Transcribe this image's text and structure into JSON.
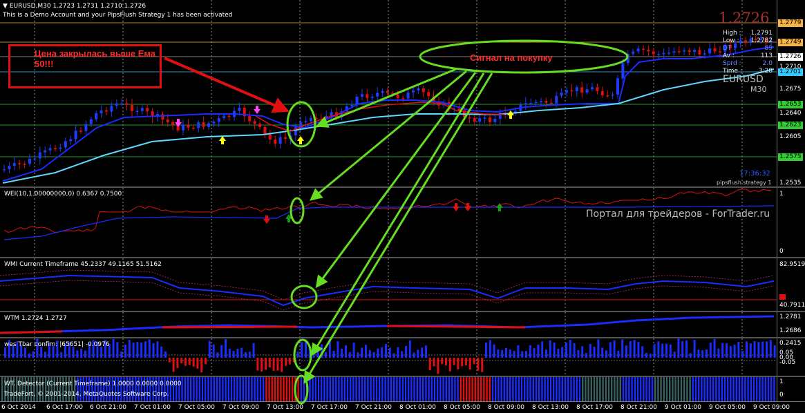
{
  "header": {
    "symbol_line": "EURUSD,M30  1.2723 1.2731 1.2710 1.2726",
    "notice": "This is a Demo Account and your PipsFlush Strategy 1 has been activated"
  },
  "big_price": "1.2726",
  "info_panel": {
    "high_label": "High :",
    "high": "1.2791",
    "low_label": "Low :",
    "low": "1.2782",
    "dt_label": "DT :",
    "dt": "89",
    "av_label": "Av :",
    "av": "113",
    "sprd_label": "Sprd :",
    "sprd": "2.0",
    "time_label": "Time :",
    "time": "3:28"
  },
  "watermark_symbol": "EURUSD",
  "watermark_tf": "M30",
  "clock": "17:36:32",
  "strategy_label": "pipsflush strategy 1",
  "annotation_left": "Цена закрылась выше Ема 50!!!",
  "annotation_buy": "Сигнал на покупку",
  "portal": "Портал для трейдеров - ForTrader.ru",
  "price_axis": [
    "1.2710",
    "1.2675",
    "1.2640",
    "1.2605",
    "1.2535"
  ],
  "levels": [
    {
      "label": "1.2779",
      "color": "#f4b342"
    },
    {
      "label": "1.2749",
      "color": "#f4b342"
    },
    {
      "label": "1.2726",
      "color": "#ffffff"
    },
    {
      "label": "1.2701",
      "color": "#33c8ff"
    },
    {
      "label": "1.2653",
      "color": "#33cc33"
    },
    {
      "label": "1.2623",
      "color": "#33cc33"
    },
    {
      "label": "1.2575",
      "color": "#33cc33"
    }
  ],
  "wei": {
    "label": "WEI(10,1.00000000,0) 0.6367 0.7500",
    "axis_top": "1",
    "axis_bottom": "0"
  },
  "wmi": {
    "label": "WMI Current Timeframe 45.2337 49.1165 51.5162",
    "axis_top": "82.9519",
    "axis_bottom": "40.7911"
  },
  "wtm": {
    "label": "WTM 1.2724 1.2727",
    "axis_top": "1.2781",
    "axis_bottom": "1.2686"
  },
  "wes": {
    "label": "wes Tbar confim: |65651| -0.0976",
    "axis": [
      "0.2415",
      "0.05",
      "0.00",
      "-0.05"
    ]
  },
  "detector": {
    "label": "WT. Detector (Current Timeframe) 1.0000 0.0000 0.0000",
    "copyright": "TradeFort, © 2001-2014, MetaQuotes Software Corp.",
    "axis_top": "1",
    "axis_bottom": "0"
  },
  "time_axis": [
    "6 Oct 2014",
    "6 Oct 17:00",
    "6 Oct 21:00",
    "7 Oct 01:00",
    "7 Oct 05:00",
    "7 Oct 09:00",
    "7 Oct 13:00",
    "7 Oct 17:00",
    "7 Oct 21:00",
    "8 Oct 01:00",
    "8 Oct 05:00",
    "8 Oct 09:00",
    "8 Oct 13:00",
    "8 Oct 17:00",
    "8 Oct 21:00",
    "9 Oct 01:00",
    "9 Oct 05:00",
    "9 Oct 09:00"
  ],
  "colors": {
    "bull": "#1e3cff",
    "bear": "#e01010",
    "ema_fast": "#1a2cff",
    "ema_slow": "#5fd8ff",
    "annotation": "#66dd22",
    "callout": "#e01010"
  }
}
